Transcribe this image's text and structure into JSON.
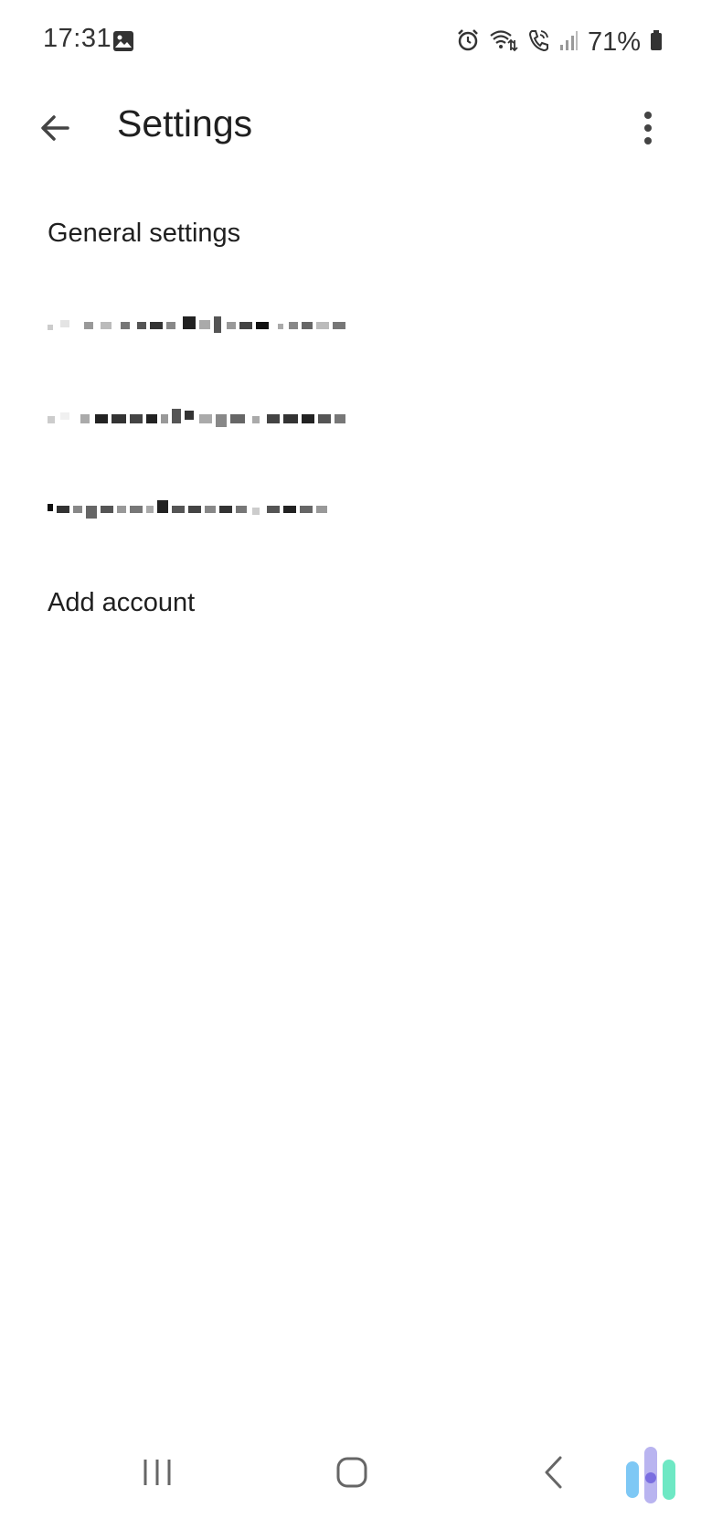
{
  "status_bar": {
    "time": "17:31",
    "battery": "71%",
    "icons": [
      "gallery-icon",
      "alarm-icon",
      "wifi-calling-icon",
      "call-icon",
      "signal-icon",
      "battery-icon"
    ]
  },
  "app_bar": {
    "title": "Settings",
    "back_icon": "arrow-back-icon",
    "menu_icon": "more-vert-icon"
  },
  "list": {
    "general_settings": "General settings",
    "add_account": "Add account"
  },
  "nav_bar": {
    "icons": [
      "recents-icon",
      "home-icon",
      "back-icon"
    ]
  },
  "colors": {
    "text": "#1f1f1f",
    "icon": "#5f6368",
    "background": "#ffffff"
  }
}
